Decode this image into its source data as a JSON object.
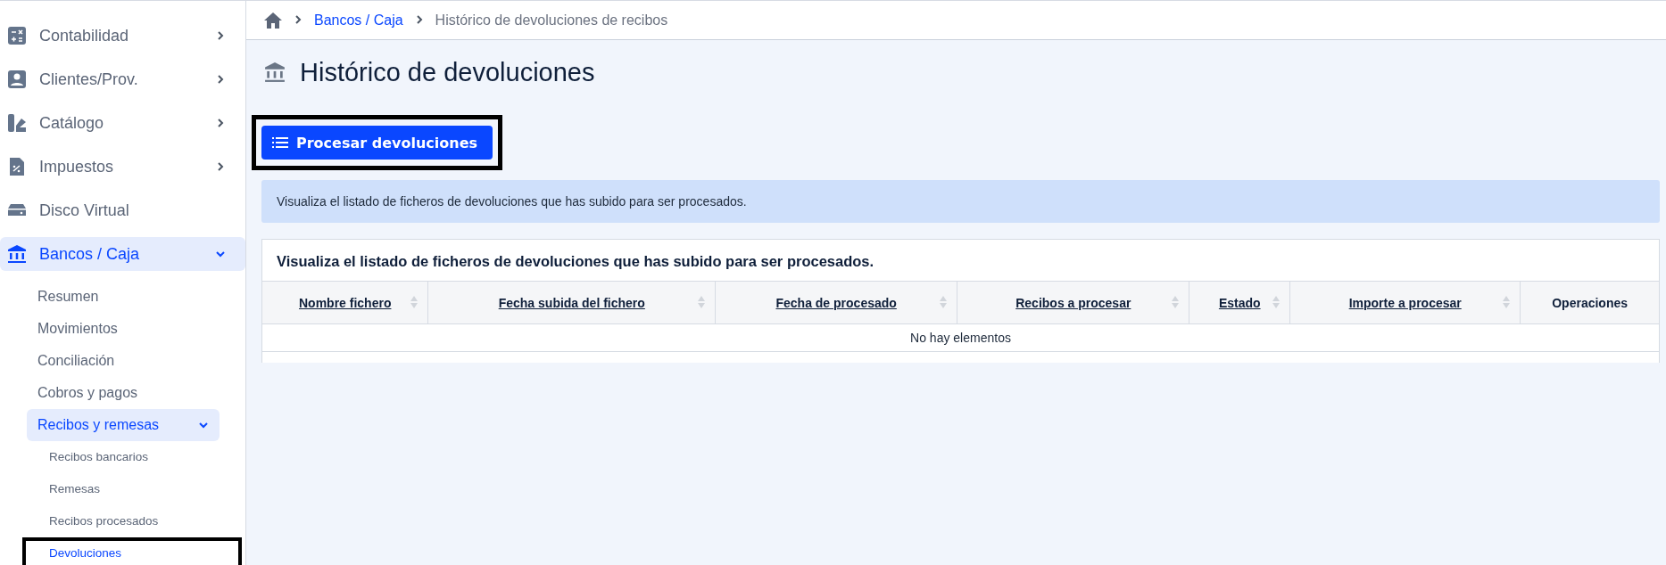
{
  "sidebar": {
    "items": [
      {
        "label": "Contabilidad",
        "kind": "group",
        "expanded": false,
        "selected": false
      },
      {
        "label": "Clientes/Prov.",
        "kind": "group",
        "expanded": false,
        "selected": false
      },
      {
        "label": "Catálogo",
        "kind": "group",
        "expanded": false,
        "selected": false
      },
      {
        "label": "Impuestos",
        "kind": "group",
        "expanded": false,
        "selected": false
      },
      {
        "label": "Disco Virtual",
        "kind": "link",
        "selected": false
      },
      {
        "label": "Bancos / Caja",
        "kind": "group",
        "expanded": true,
        "selected": true,
        "children": [
          {
            "label": "Resumen",
            "kind": "link",
            "selected": false
          },
          {
            "label": "Movimientos",
            "kind": "link",
            "selected": false
          },
          {
            "label": "Conciliación",
            "kind": "link",
            "selected": false
          },
          {
            "label": "Cobros y pagos",
            "kind": "link",
            "selected": false
          },
          {
            "label": "Recibos y remesas",
            "kind": "group",
            "selected": true,
            "expanded": true,
            "children": [
              {
                "label": "Recibos bancarios",
                "selected": false,
                "highlighted": false
              },
              {
                "label": "Remesas",
                "selected": false,
                "highlighted": false
              },
              {
                "label": "Recibos procesados",
                "selected": false,
                "highlighted": false
              },
              {
                "label": "Devoluciones",
                "selected": true,
                "highlighted": true
              }
            ]
          }
        ]
      }
    ]
  },
  "breadcrumb": [
    {
      "label": "Bancos / Caja",
      "kind": "link"
    },
    {
      "label": "Histórico de devoluciones de recibos",
      "kind": "current"
    }
  ],
  "page": {
    "title": "Histórico de devoluciones",
    "action_button": {
      "label": "Procesar devoluciones",
      "highlighted": true
    },
    "info": "Visualiza el listado de ficheros de devoluciones que has subido para ser procesados.",
    "table": {
      "title": "Visualiza el listado de ficheros de devoluciones que has subido para ser procesados.",
      "columns": [
        {
          "label": "Nombre fichero",
          "sortable": true
        },
        {
          "label": "Fecha subida del fichero",
          "sortable": true
        },
        {
          "label": "Fecha de procesado",
          "sortable": true
        },
        {
          "label": "Recibos a procesar",
          "sortable": true
        },
        {
          "label": "Estado",
          "sortable": true
        },
        {
          "label": "Importe a procesar",
          "sortable": true
        },
        {
          "label": "Operaciones",
          "sortable": false
        }
      ],
      "empty_message": "No hay elementos"
    }
  }
}
